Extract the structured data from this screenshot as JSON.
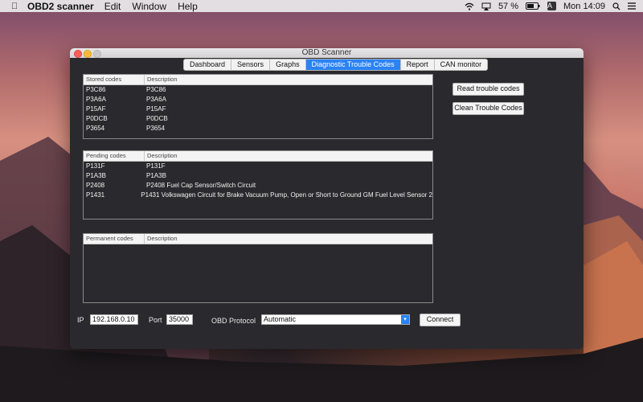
{
  "menubar": {
    "app_name": "OBD2 scanner",
    "items": [
      "Edit",
      "Window",
      "Help"
    ],
    "battery": "57 %",
    "input_source": "A",
    "clock": "Mon 14:09"
  },
  "window": {
    "title": "OBD Scanner",
    "tabs": [
      {
        "label": "Dashboard",
        "active": false
      },
      {
        "label": "Sensors",
        "active": false
      },
      {
        "label": "Graphs",
        "active": false
      },
      {
        "label": "Diagnostic Trouble Codes",
        "active": true
      },
      {
        "label": "Report",
        "active": false
      },
      {
        "label": "CAN monitor",
        "active": false
      }
    ]
  },
  "stored": {
    "header_code": "Stored codes",
    "header_desc": "Description",
    "rows": [
      {
        "code": "P3C86",
        "desc": "P3C86"
      },
      {
        "code": "P3A6A",
        "desc": "P3A6A"
      },
      {
        "code": "P15AF",
        "desc": "P15AF"
      },
      {
        "code": "P0DCB",
        "desc": "P0DCB"
      },
      {
        "code": "P3654",
        "desc": "P3654"
      }
    ]
  },
  "pending": {
    "header_code": "Pending codes",
    "header_desc": "Description",
    "rows": [
      {
        "code": "P131F",
        "desc": "P131F"
      },
      {
        "code": "P1A3B",
        "desc": "P1A3B"
      },
      {
        "code": "P2408",
        "desc": "P2408  Fuel Cap Sensor/Switch Circuit"
      },
      {
        "code": "P1431",
        "desc": "P1431 Volkswagen Circuit for Brake Vacuum Pump, Open or Short to Ground GM Fuel Level Sensor 2"
      }
    ]
  },
  "permanent": {
    "header_code": "Permanent codes",
    "header_desc": "Description",
    "rows": []
  },
  "buttons": {
    "read": "Read trouble codes",
    "clean": "Clean Trouble Codes",
    "connect": "Connect"
  },
  "connection": {
    "ip_label": "IP",
    "ip_value": "192.168.0.10",
    "port_label": "Port",
    "port_value": "35000",
    "protocol_label": "OBD Protocol",
    "protocol_value": "Automatic"
  }
}
